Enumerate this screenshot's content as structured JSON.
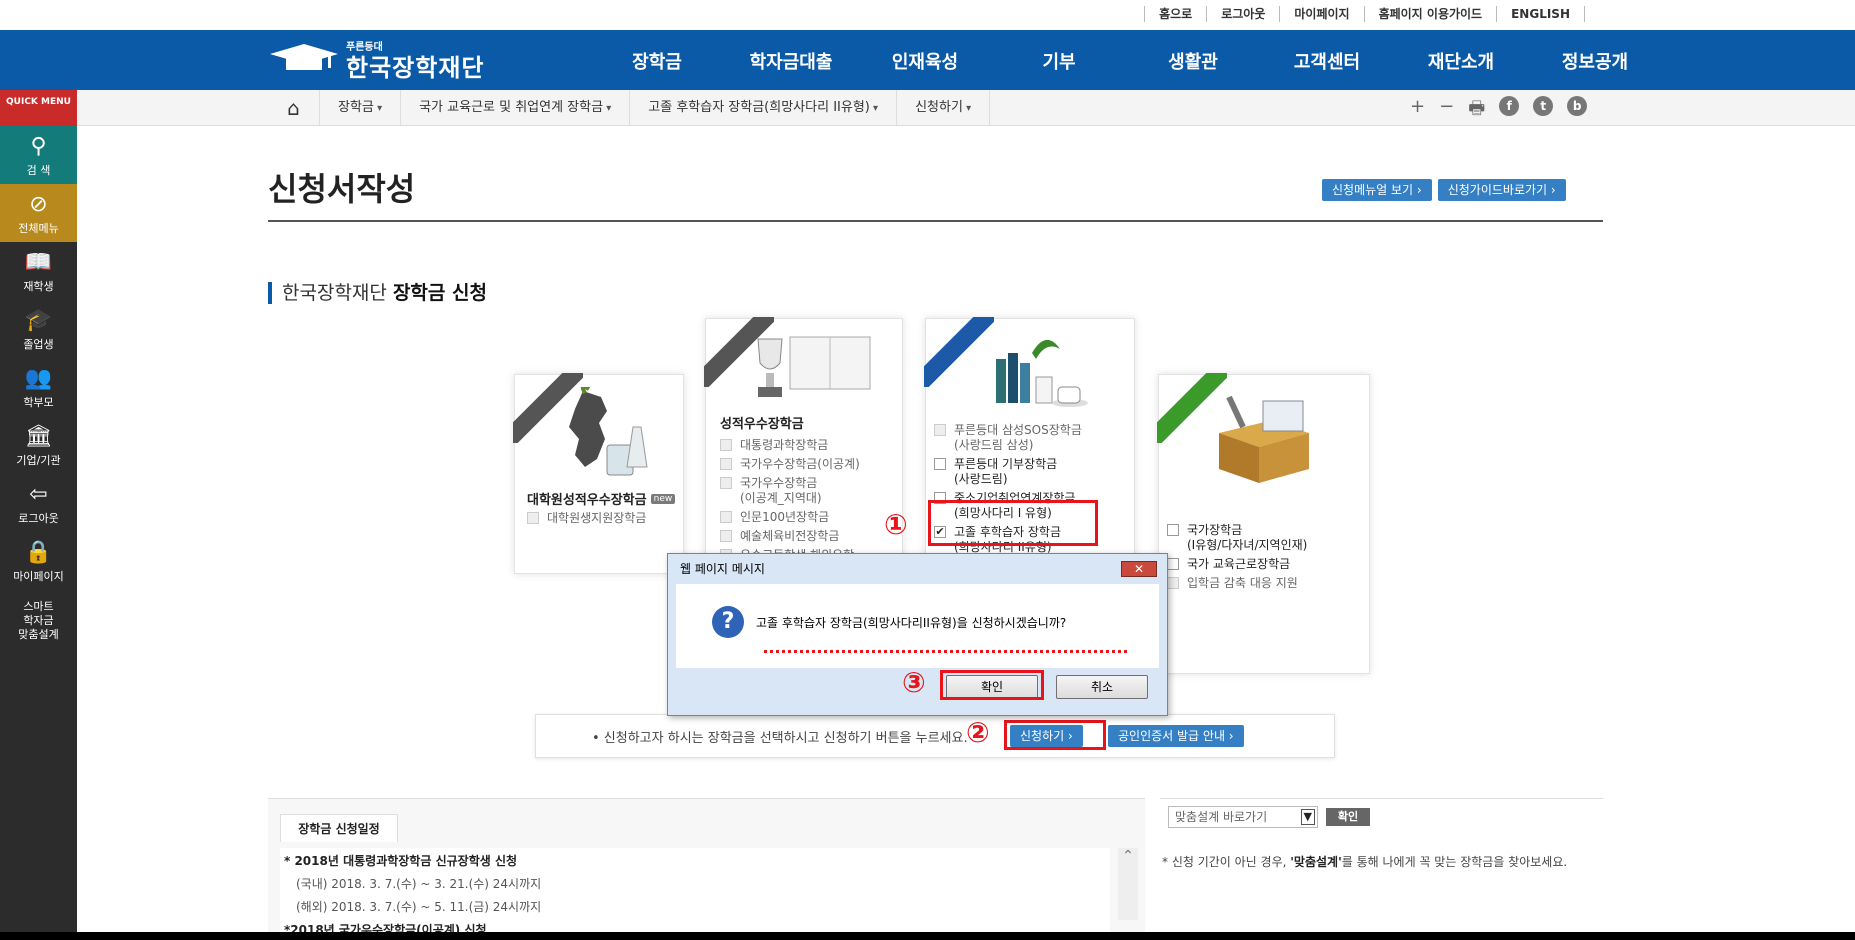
{
  "top_links": [
    "홈으로",
    "로그아웃",
    "마이페이지",
    "홈페이지 이용가이드",
    "ENGLISH"
  ],
  "logo": {
    "small": "푸른등대",
    "big": "한국장학재단"
  },
  "main_nav": [
    "장학금",
    "학자금대출",
    "인재육성",
    "기부",
    "생활관",
    "고객센터",
    "재단소개",
    "정보공개"
  ],
  "quick_menu": {
    "head": "QUICK MENU",
    "items": [
      {
        "label": "검 색",
        "icon": "search-icon"
      },
      {
        "label": "전체메뉴",
        "icon": "compass-icon"
      },
      {
        "label": "재학생",
        "icon": "book-icon"
      },
      {
        "label": "졸업생",
        "icon": "graduation-cap-icon"
      },
      {
        "label": "학부모",
        "icon": "people-icon"
      },
      {
        "label": "기업/기관",
        "icon": "institution-icon"
      },
      {
        "label": "로그아웃",
        "icon": "logout-icon"
      },
      {
        "label": "마이페이지",
        "icon": "lock-icon"
      },
      {
        "label": "스마트\n학자금\n맞춤설계",
        "icon": ""
      }
    ]
  },
  "breadcrumb": [
    "장학금",
    "국가 교육근로 및 취업연계 장학금",
    "고졸 후학습자 장학금(희망사다리 II유형)",
    "신청하기"
  ],
  "share": [
    "+",
    "−"
  ],
  "page_title": "신청서작성",
  "guide_buttons": [
    "신청메뉴얼 보기 ›",
    "신청가이드바로가기 ›"
  ],
  "section": {
    "prefix": "한국장학재단",
    "bold": "장학금 신청"
  },
  "cards": {
    "c1": {
      "title": "대학원성적우수장학금",
      "badge": "new",
      "items": [
        "대학원생지원장학금"
      ]
    },
    "c2": {
      "title": "성적우수장학금",
      "items": [
        "대통령과학장학금",
        "국가우수장학금(이공계)",
        "국가우수장학금\n(이공계_지역대)",
        "인문100년장학금",
        "예술체육비전장학금",
        "우수고등학생 해외유학"
      ]
    },
    "c3": {
      "items": [
        "푸른등대 삼성SOS장학금\n(사랑드림 삼성)",
        "푸른등대 기부장학금\n(사랑드림)",
        "중소기업취업연계장학금\n(희망사다리 I 유형)",
        "고졸 후학습자 장학금\n(희망사다리 II유형)"
      ]
    },
    "c4": {
      "items": [
        "국가장학금\n(I유형/다자녀/지역인재)",
        "국가 교육근로장학금",
        "입학금 감축 대응 지원"
      ]
    }
  },
  "annotations": [
    "①",
    "②",
    "③"
  ],
  "dialog": {
    "title": "웹 페이지 메시지",
    "close": "✕",
    "message": "고졸 후학습자 장학금(희망사다리II유형)을 신청하시겠습니까?",
    "ok": "확인",
    "cancel": "취소"
  },
  "apply": {
    "text": "• 신청하고자 하시는 장학금을 선택하시고 신청하기 버튼을 누르세요.",
    "apply_button": "신청하기 ›",
    "cert_button": "공인인증서 발급 안내 ›"
  },
  "schedule": {
    "tab": "장학금 신청일정",
    "entries": [
      {
        "head": "* 2018년 대통령과학장학금 신규장학생 신청",
        "lines": [
          "(국내) 2018. 3. 7.(수) ~ 3. 21.(수) 24시까지",
          "(해외) 2018. 3. 7.(수) ~ 5. 11.(금) 24시까지"
        ]
      },
      {
        "head": "*2018년 국가우수장학금(이공계) 신청",
        "lines": []
      }
    ]
  },
  "fit": {
    "select_value": "맞춤설계 바로가기",
    "ok": "확인",
    "note_prefix": "* 신청 기간이 아닌 경우, ",
    "note_bold": "'맞춤설계'",
    "note_suffix": "를 통해 나에게 꼭 맞는 장학금을 찾아보세요."
  },
  "colors": {
    "brand_blue": "#0a5aa7",
    "accent_red": "#e8141a",
    "button_blue": "#3580c4"
  }
}
